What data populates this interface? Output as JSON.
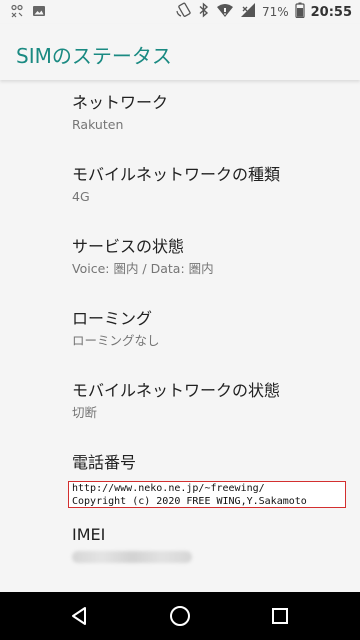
{
  "status_bar": {
    "battery_percent": "71%",
    "time": "20:55",
    "icons": [
      "usb-debug-icon",
      "image-icon",
      "rotate-icon",
      "bluetooth-icon",
      "wifi-icon",
      "cell-signal-icon",
      "battery-icon"
    ]
  },
  "app_bar": {
    "title": "SIMのステータス"
  },
  "items": [
    {
      "title": "ネットワーク",
      "summary": "Rakuten"
    },
    {
      "title": "モバイルネットワークの種類",
      "summary": "4G"
    },
    {
      "title": "サービスの状態",
      "summary": "Voice: 圏内 / Data: 圏内"
    },
    {
      "title": "ローミング",
      "summary": "ローミングなし"
    },
    {
      "title": "モバイルネットワークの状態",
      "summary": "切断"
    },
    {
      "title": "電話番号",
      "summary": ""
    },
    {
      "title": "IMEI",
      "summary": ""
    }
  ],
  "watermark": {
    "line1": "http://www.neko.ne.jp/~freewing/",
    "line2": "Copyright (c) 2020 FREE WING,Y.Sakamoto"
  },
  "nav_bar": {
    "icons": [
      "back-icon",
      "home-icon",
      "recents-icon"
    ]
  }
}
